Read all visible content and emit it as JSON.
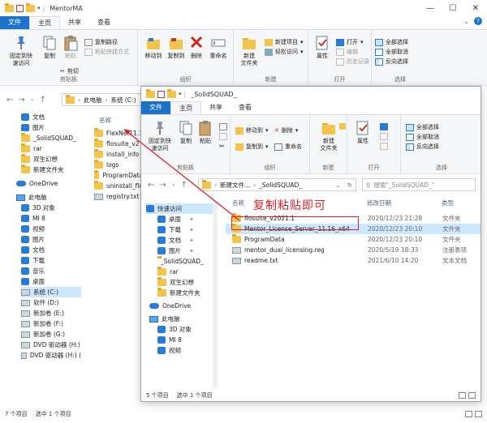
{
  "back_window": {
    "title": "MentorMA",
    "tabs": [
      "文件",
      "主页",
      "共享",
      "查看"
    ],
    "ribbon": {
      "clipboard": {
        "pin": "固定到快\n速访问",
        "copy": "复制",
        "paste": "粘贴",
        "copy_path": "复制路径",
        "paste_shortcut": "粘贴快捷方式",
        "cut": "剪切",
        "label": "剪贴板"
      },
      "organize": {
        "move_to": "移动到",
        "copy_to": "复制到",
        "delete": "删除",
        "rename": "重命名",
        "label": "组织"
      },
      "new": {
        "new_folder": "新建\n文件夹",
        "new_item": "新建项目",
        "easy_access": "轻松访问",
        "label": "新建"
      },
      "open": {
        "properties": "属性",
        "open": "打开",
        "edit": "编辑",
        "history": "历史记录",
        "label": "打开"
      },
      "select": {
        "select_all": "全部选择",
        "select_none": "全部取消",
        "invert": "反向选择",
        "label": "选择"
      }
    },
    "breadcrumb": [
      "此电脑",
      "系统 (C:)"
    ],
    "nav": [
      "文档",
      "图片",
      "_SolidSQUAD_",
      "rar",
      "双生幻想",
      "新建文件夹",
      "OneDrive",
      "此电脑",
      "3D 对象",
      "MI 8",
      "视频",
      "图片",
      "文档",
      "下载",
      "音乐",
      "桌面",
      "系统 (C:)",
      "软件 (D:)",
      "新加卷 (E:)",
      "新加卷 (F:)",
      "新加卷 (G:)",
      "DVD 驱动器 (H:)",
      "DVD 驱动器 (H:) ("
    ],
    "column_name": "名称",
    "files": [
      "FlexNet11.1",
      "flosuite_v2",
      "install_info",
      "logs",
      "ProgramData",
      "uninstall_flo",
      "registry.txt"
    ],
    "status": {
      "count": "7 个项目",
      "selected": "选中 1 个项目"
    }
  },
  "front_window": {
    "title": "_SolidSQUAD_",
    "tabs": [
      "文件",
      "主页",
      "共享",
      "查看"
    ],
    "ribbon": {
      "clipboard": {
        "pin": "固定到快\n速访问",
        "copy": "复制",
        "paste": "粘贴",
        "label": "剪贴板"
      },
      "organize": {
        "move_to": "移动到",
        "copy_to": "复制到",
        "delete": "删除",
        "rename": "重命名",
        "label": "组织"
      },
      "new": {
        "new_folder": "新建\n文件夹",
        "label": "新建"
      },
      "open": {
        "properties": "属性",
        "label": "打开"
      },
      "select": {
        "select_all": "全部选择",
        "select_none": "全部取消",
        "invert": "反向选择",
        "label": "选择"
      }
    },
    "breadcrumb": [
      "新建文件...",
      "_SolidSQUAD_"
    ],
    "search_placeholder": "搜索\"_SolidSQUAD_\"",
    "nav": [
      "快速访问",
      "桌面",
      "下载",
      "文档",
      "图片",
      "_SolidSQUAD_",
      "rar",
      "双生幻想",
      "新建文件夹",
      "OneDrive",
      "此电脑",
      "3D 对象",
      "MI 8",
      "视频"
    ],
    "columns": {
      "name": "名称",
      "date": "修改日期",
      "type": "类型"
    },
    "files": [
      {
        "name": "flosuite_v2021.1",
        "date": "2020/12/23 21:28",
        "type": "文件夹"
      },
      {
        "name": "Mentor_License_Server_11.16_x64",
        "date": "2020/12/23 20:10",
        "type": "文件夹"
      },
      {
        "name": "ProgramData",
        "date": "2020/12/23 20:10",
        "type": "文件夹"
      },
      {
        "name": "mentor_dual_licensing.reg",
        "date": "2020/5/19 18:33",
        "type": "注册表项"
      },
      {
        "name": "readme.txt",
        "date": "2021/6/10 14:20",
        "type": "文本文档"
      }
    ],
    "status": {
      "count": "5 个项目",
      "selected": "选中 1 个项目"
    }
  },
  "annotation": "复制粘贴即可",
  "colors": {
    "accent": "#1a73c8",
    "selection": "#cce8ff",
    "annotation": "#e0202a"
  }
}
